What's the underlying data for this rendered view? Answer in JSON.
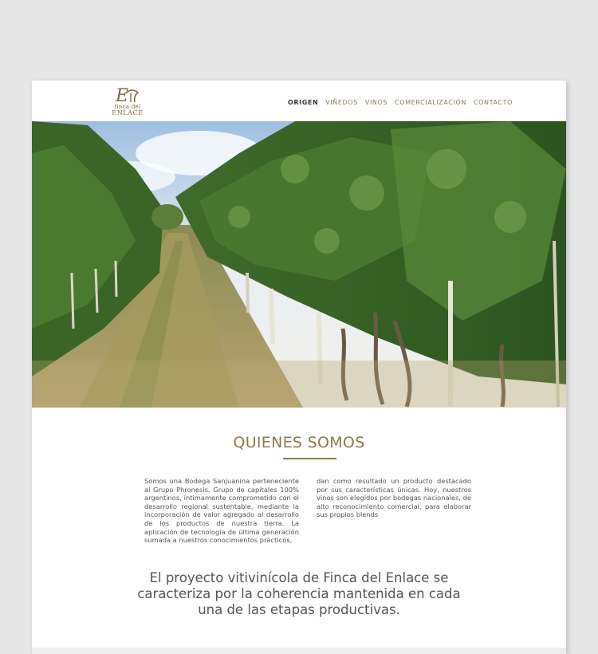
{
  "brand": {
    "monogram": "E",
    "line1": "finca del",
    "line2": "ENLACE",
    "color": "#7a6a45"
  },
  "nav": {
    "items": [
      {
        "label": "ORIGEN",
        "active": true
      },
      {
        "label": "VIÑEDOS",
        "active": false
      },
      {
        "label": "VINOS",
        "active": false
      },
      {
        "label": "COMERCIALIZACIÓN",
        "active": false
      },
      {
        "label": "CONTACTO",
        "active": false
      }
    ]
  },
  "hero": {
    "image": "vineyard-rows-photo"
  },
  "about": {
    "title": "QUIENES SOMOS",
    "accent_color": "#8c7a4c",
    "col_left": "Somos una Bodega Sanjuanina perteneciente al Grupo Phronesis. Grupo de capitales 100% argentinos, íntimamente comprometido con el desarrollo regional sustentable, mediante la incorporación de valor agregado al desarrollo de los productos de nuestra tierra. La aplicación de tecnología de última generación sumada a nuestros conocimientos prácticos,",
    "col_right": "dan como resultado un producto destacado por sus características únicas. Hoy, nuestros vinos son elegidos por bodegas nacionales, de alto reconocimiento comercial, para elaborar sus propios blends",
    "quote": "El proyecto vitivinícola de Finca del Enlace se caracteriza por la coherencia mantenida en cada una de las etapas productivas."
  }
}
